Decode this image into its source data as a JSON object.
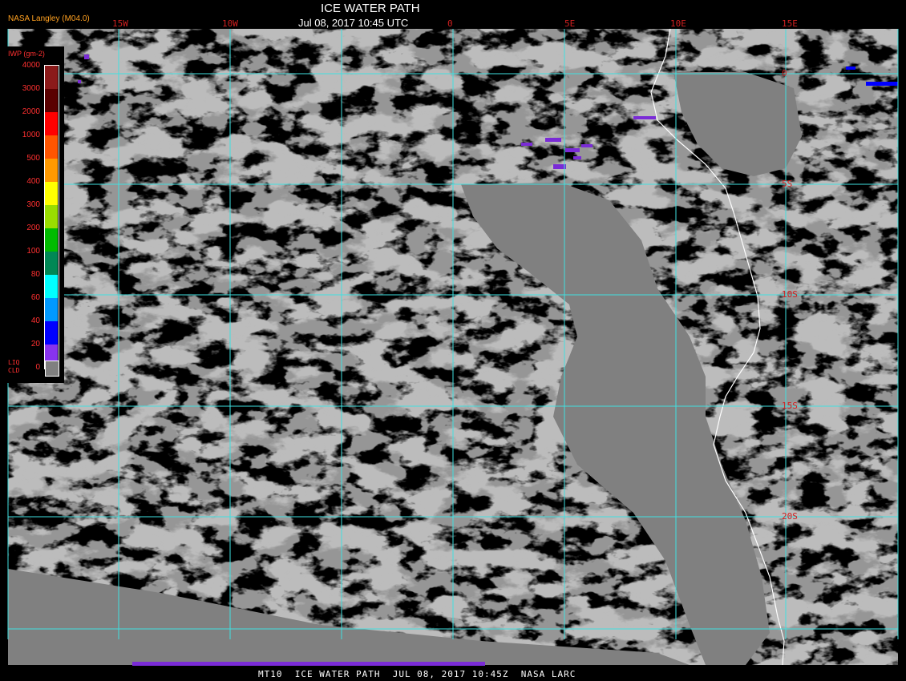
{
  "header": {
    "title": "ICE WATER PATH",
    "datetime": "Jul 08, 2017 10:45 UTC",
    "brand": "NASA Langley (M04.0)"
  },
  "footer": {
    "text": "MT10  ICE WATER PATH  JUL 08, 2017 10:45Z  NASA LARC"
  },
  "legend": {
    "title": "IWP (gm-2)",
    "levels": [
      "4000",
      "3000",
      "2000",
      "1000",
      "500",
      "400",
      "300",
      "200",
      "100",
      "80",
      "60",
      "40",
      "20",
      "0"
    ],
    "colors": [
      "#8b1a1a",
      "#5a0000",
      "#ff0000",
      "#ff5500",
      "#ff9900",
      "#ffff00",
      "#99dd00",
      "#00bb00",
      "#008855",
      "#00ffff",
      "#0099ff",
      "#0000ff",
      "#8833ee"
    ],
    "liq_label": "LIQ\nCLD",
    "liq_color": "#808080"
  },
  "grid": {
    "lon_labels": [
      "15W",
      "10W",
      "0",
      "5E",
      "10E",
      "15E"
    ],
    "lat_labels": [
      "0",
      "5S",
      "10S",
      "15S",
      "20S"
    ]
  },
  "colors": {
    "cloud": "#808080",
    "grid": "#40e0e0",
    "coast": "#ffffff",
    "ice": "#7a2bd6",
    "label": "#d02020"
  }
}
